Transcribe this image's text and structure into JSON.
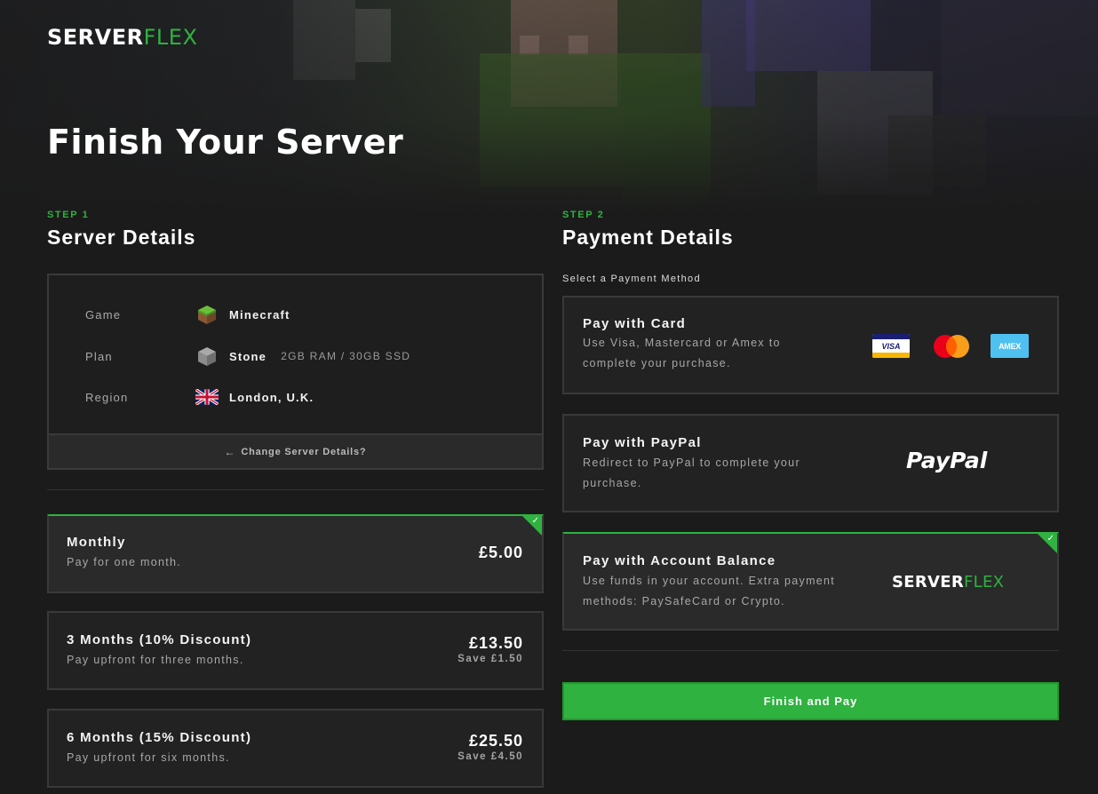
{
  "brand": {
    "logo_primary": "SERVER",
    "logo_accent": "FLEX",
    "accent_color": "#2fb240"
  },
  "page_title": "Finish Your Server",
  "step1": {
    "label": "STEP 1",
    "title": "Server Details",
    "details": {
      "game": {
        "key": "Game",
        "value": "Minecraft",
        "icon": "grass-block-icon"
      },
      "plan": {
        "key": "Plan",
        "value": "Stone",
        "spec": "2GB RAM / 30GB SSD",
        "icon": "stone-block-icon"
      },
      "region": {
        "key": "Region",
        "value": "London, U.K.",
        "icon": "uk-flag-icon"
      }
    },
    "change_link": "Change Server Details?",
    "billing_options": [
      {
        "title": "Monthly",
        "description": "Pay for one month.",
        "price": "£5.00",
        "save": "",
        "selected": true
      },
      {
        "title": "3 Months (10% Discount)",
        "description": "Pay upfront for three months.",
        "price": "£13.50",
        "save": "Save £1.50",
        "selected": false
      },
      {
        "title": "6 Months (15% Discount)",
        "description": "Pay upfront for six months.",
        "price": "£25.50",
        "save": "Save £4.50",
        "selected": false
      }
    ]
  },
  "step2": {
    "label": "STEP 2",
    "title": "Payment Details",
    "select_label": "Select a Payment Method",
    "methods": [
      {
        "title": "Pay with Card",
        "description_line1": "Use Visa, Mastercard or Amex to",
        "description_line2": "complete your purchase.",
        "icons": [
          "visa-icon",
          "mastercard-icon",
          "amex-icon"
        ],
        "selected": false
      },
      {
        "title": "Pay with PayPal",
        "description_line1": "Redirect to PayPal to complete your",
        "description_line2": "purchase.",
        "logo_text": "PayPal",
        "selected": false
      },
      {
        "title": "Pay with Account Balance",
        "description_line1": "Use funds in your account. Extra payment",
        "description_line2": "methods: PaySafeCard or Crypto.",
        "logo_primary": "SERVER",
        "logo_accent": "FLEX",
        "selected": true
      }
    ],
    "card_logos": {
      "visa": "VISA",
      "amex": "AMEX"
    },
    "finish_button": "Finish and Pay"
  }
}
